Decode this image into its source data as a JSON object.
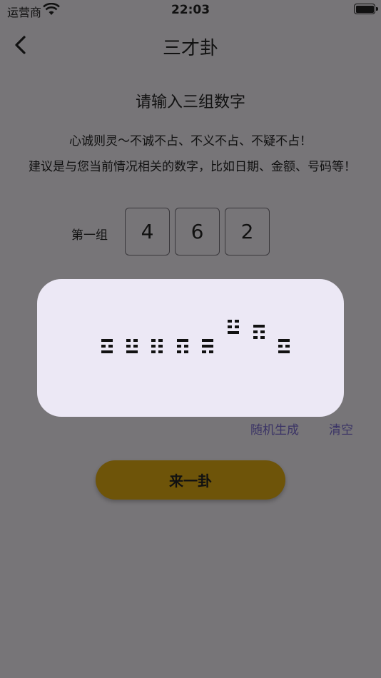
{
  "status_bar": {
    "carrier": "运营商",
    "time": "22:03"
  },
  "nav": {
    "title": "三才卦"
  },
  "page": {
    "subtitle": "请输入三组数字",
    "motto": "心诚则灵～不诚不占、不义不占、不疑不占！",
    "advice": "建议是与您当前情况相关的数字，比如日期、金额、号码等！"
  },
  "group": {
    "label": "第一组",
    "digits": [
      "4",
      "6",
      "2"
    ]
  },
  "links": {
    "random": "随机生成",
    "clear": "清空"
  },
  "cta": {
    "label": "来一卦"
  },
  "loading": {
    "trigrams": [
      {
        "lines": [
          "solid",
          "broken",
          "solid"
        ]
      },
      {
        "lines": [
          "broken",
          "broken",
          "solid"
        ]
      },
      {
        "lines": [
          "broken",
          "broken",
          "broken"
        ]
      },
      {
        "lines": [
          "solid",
          "broken",
          "broken"
        ]
      },
      {
        "lines": [
          "solid",
          "solid",
          "broken"
        ]
      },
      {
        "lines": [
          "broken",
          "broken",
          "solid"
        ]
      },
      {
        "lines": [
          "solid",
          "broken",
          "broken"
        ]
      },
      {
        "lines": [
          "solid",
          "broken",
          "solid"
        ]
      }
    ]
  }
}
